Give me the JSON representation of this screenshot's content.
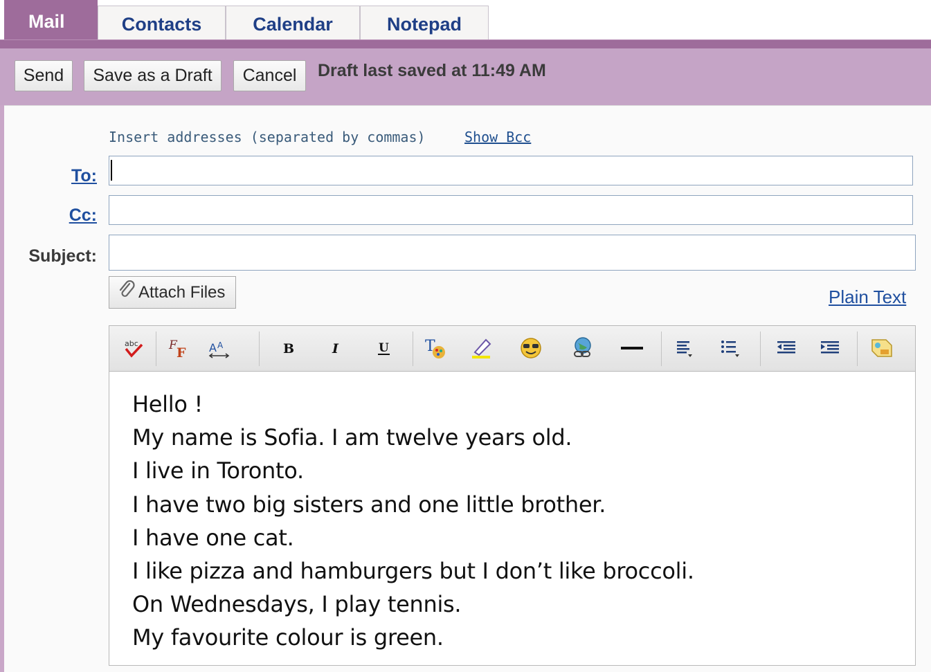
{
  "tabs": [
    {
      "label": "Mail",
      "active": true
    },
    {
      "label": "Contacts",
      "active": false
    },
    {
      "label": "Calendar",
      "active": false
    },
    {
      "label": "Notepad",
      "active": false
    }
  ],
  "toolbar": {
    "send_label": "Send",
    "save_draft_label": "Save as a Draft",
    "cancel_label": "Cancel",
    "status": "Draft last saved at 11:49 AM"
  },
  "compose": {
    "address_hint": "Insert addresses (separated by commas)",
    "show_bcc": "Show Bcc",
    "to_label": "To:",
    "to_value": "",
    "cc_label": "Cc:",
    "cc_value": "",
    "subject_label": "Subject:",
    "subject_value": "",
    "attach_label": "Attach Files",
    "plain_text_link": "Plain Text"
  },
  "editor_toolbar": [
    "spell-check",
    "font-face",
    "font-size",
    "bold",
    "italic",
    "underline",
    "text-color",
    "highlight",
    "emoticon",
    "insert-link",
    "horizontal-rule",
    "align",
    "bulleted-list",
    "outdent",
    "indent",
    "stationery"
  ],
  "body_lines": [
    "Hello !",
    "My name is Sofia. I am twelve years old.",
    "I live in Toronto.",
    "I have two big sisters and one little brother.",
    "I have one cat.",
    "I like pizza and hamburgers but I don’t like broccoli.",
    "On Wednesdays, I play tennis.",
    "My favourite colour is green."
  ],
  "colors": {
    "accent": "#9e6c9b",
    "toolbar_bg": "#c5a4c6",
    "link": "#1f4f9f"
  }
}
